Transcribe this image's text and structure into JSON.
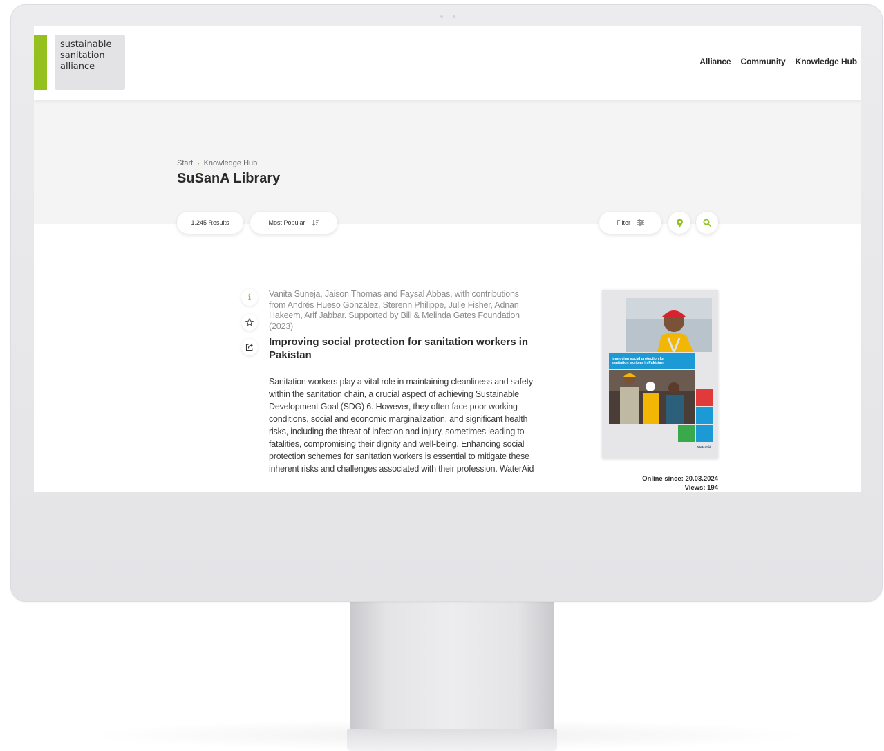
{
  "site": {
    "logo_lines": [
      "sustainable",
      "sanitation",
      "alliance"
    ],
    "nav": [
      "Alliance",
      "Community",
      "Knowledge Hub"
    ],
    "brand_color": "#95c11f"
  },
  "breadcrumb": {
    "start": "Start",
    "section": "Knowledge Hub"
  },
  "page_title": "SuSanA Library",
  "toolbar": {
    "results": "1.245 Results",
    "sort": "Most Popular",
    "filter": "Filter"
  },
  "result": {
    "authors": "Vanita Suneja, Jaison Thomas and Faysal Abbas, with contributions from Andrés Hueso González, Sterenn Philippe, Julie Fisher, Adnan Hakeem, Arif Jabbar. Supported by Bill & Melinda Gates Foundation (2023)",
    "title": "Improving social protection for sanitation workers in Pakistan",
    "abstract": "Sanitation workers play a vital role in maintaining cleanliness and safety within the sanitation chain, a crucial aspect of achieving Sustainable Development Goal (SDG) 6. However, they often face poor working conditions, social and economic marginalization, and significant health risks, including the threat of infection and injury, sometimes leading to fatalities, compromising their dignity and well-being. Enhancing social protection schemes for sanitation workers is essential to mitigate these inherent risks and challenges associated with their profession. WaterAid",
    "cover_caption": "Improving social protection for sanitation workers in Pakistan",
    "cover_brand": "WaterAid",
    "online_since": "Online since: 20.03.2024",
    "views": "Views: 194"
  }
}
